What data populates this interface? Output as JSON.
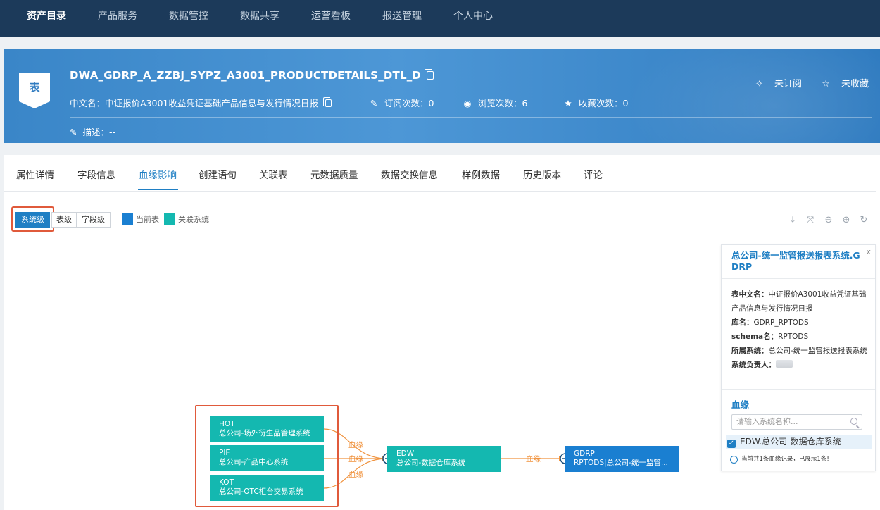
{
  "nav": {
    "items": [
      "资产目录",
      "产品服务",
      "数据管控",
      "数据共享",
      "运营看板",
      "报送管理",
      "个人中心"
    ]
  },
  "header": {
    "badge": "表",
    "table_name": "DWA_GDRP_A_ZZBJ_SYPZ_A3001_PRODUCTDETAILS_DTL_D",
    "cn_name": "中文名：中证报价A3001收益凭证基础产品信息与发行情况日报",
    "subscribe_count": "订阅次数：0",
    "view_count": "浏览次数：6",
    "favorite_count": "收藏次数：0",
    "description": "描述：--",
    "unsubscribed": "未订阅",
    "unfavorited": "未收藏"
  },
  "tabs": [
    "属性详情",
    "字段信息",
    "血缘影响",
    "创建语句",
    "关联表",
    "元数据质量",
    "数据交换信息",
    "样例数据",
    "历史版本",
    "评论"
  ],
  "toolbar": {
    "levels": [
      "系统级",
      "表级",
      "字段级"
    ],
    "legend_current": "当前表",
    "legend_related": "关联系统",
    "colors": {
      "current": "#1a7fd1",
      "related": "#14b8b0"
    }
  },
  "card": {
    "title": "总公司-统一监管报送报表系统.GDRP",
    "close": "x",
    "cn_label": "表中文名：",
    "cn_value": "中证报价A3001收益凭证基础产品信息与发行情况日报",
    "db_label": "库名：",
    "db_value": "GDRP_RPTODS",
    "schema_label": "schema名：",
    "schema_value": "RPTODS",
    "system_label": "所属系统：",
    "system_value": "总公司-统一监管报送报表系统",
    "owner_label": "系统负责人：",
    "lineage_heading": "血缘",
    "search_placeholder": "请输入系统名称...",
    "checked_item": "EDW.总公司-数据仓库系统",
    "footer": "当前共1条血缘记录，已展示1条!"
  },
  "graph": {
    "nodes": [
      {
        "code": "HOT",
        "name": "总公司-场外衍生品管理系统"
      },
      {
        "code": "PIF",
        "name": "总公司-产品中心系统"
      },
      {
        "code": "KOT",
        "name": "总公司-OTC柜台交易系统"
      },
      {
        "code": "EDW",
        "name": "总公司-数据仓库系统"
      },
      {
        "code": "GDRP",
        "name": "RPTODS|总公司-统一监管..."
      }
    ],
    "edge_label": "血缘"
  }
}
